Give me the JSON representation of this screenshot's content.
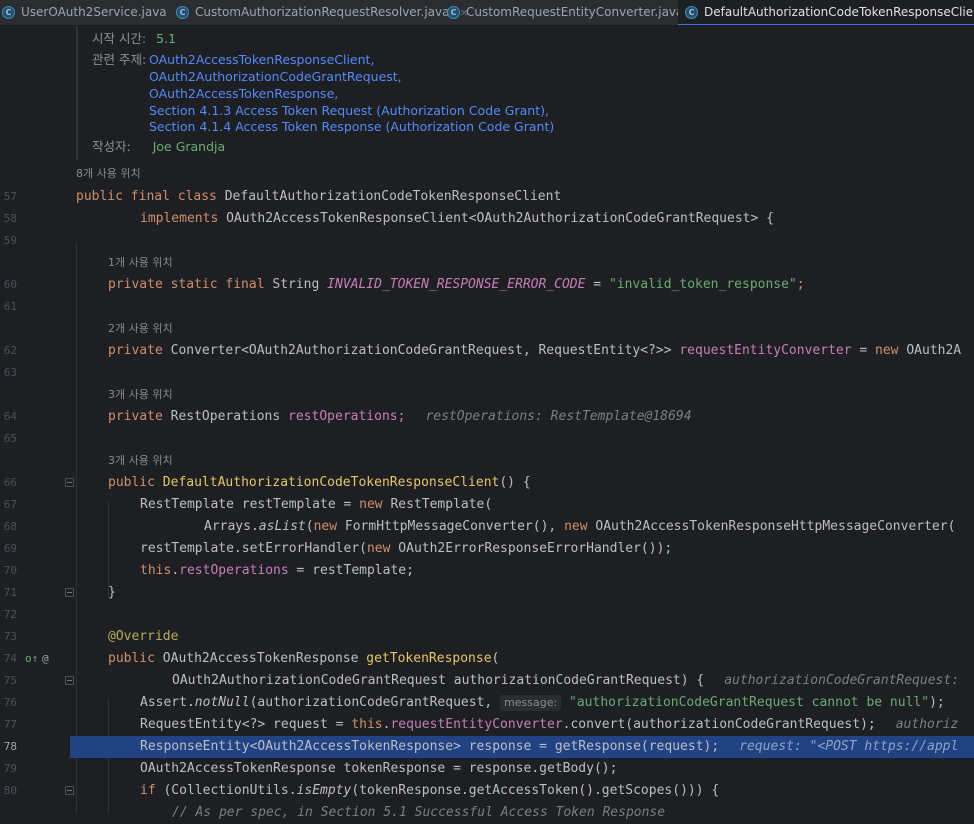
{
  "tabs": [
    {
      "label": "UserOAuth2Service.java",
      "active": false
    },
    {
      "label": "CustomAuthorizationRequestResolver.java",
      "active": false
    },
    {
      "label": "CustomRequestEntityConverter.java",
      "active": false
    },
    {
      "label": "DefaultAuthorizationCodeTokenResponseClient.java",
      "active": true
    }
  ],
  "close_glyph": "×",
  "class_icon_glyph": "C",
  "doc": {
    "since_key": "시작 시간:",
    "since_val": "5.1",
    "see_key": "관련 주제:",
    "see_links": [
      "OAuth2AccessTokenResponseClient,",
      "OAuth2AuthorizationCodeGrantRequest,",
      "OAuth2AccessTokenResponse,",
      "Section 4.1.3 Access Token Request (Authorization Code Grant),",
      "Section 4.1.4 Access Token Response (Authorization Code Grant)"
    ],
    "author_key": "작성자:",
    "author_val": "Joe Grandja"
  },
  "usage_hints": {
    "h57": "8개 사용 위치",
    "h60": "1개 사용 위치",
    "h62": "2개 사용 위치",
    "h64": "3개 사용 위치",
    "h66": "3개 사용 위치"
  },
  "line_numbers": [
    "57",
    "58",
    "59",
    "60",
    "61",
    "62",
    "63",
    "64",
    "65",
    "66",
    "67",
    "68",
    "69",
    "70",
    "71",
    "72",
    "73",
    "74",
    "75",
    "76",
    "77",
    "78",
    "79",
    "80"
  ],
  "current_line": "78",
  "code": {
    "l57": [
      "public final class ",
      "DefaultAuthorizationCodeTokenResponseClient"
    ],
    "l58": [
      "implements ",
      "OAuth2AccessTokenResponseClient<OAuth2AuthorizationCodeGrantRequest> {"
    ],
    "l60": [
      "private static final ",
      "String ",
      "INVALID_TOKEN_RESPONSE_ERROR_CODE",
      " = ",
      "\"invalid_token_response\"",
      ";"
    ],
    "l62": [
      "private ",
      "Converter<OAuth2AuthorizationCodeGrantRequest, RequestEntity<?>> ",
      "requestEntityConverter",
      " = ",
      "new ",
      "OAuth2A"
    ],
    "l64": [
      "private ",
      "RestOperations ",
      "restOperations",
      ";",
      "restOperations: RestTemplate@18694"
    ],
    "l66": [
      "public ",
      "DefaultAuthorizationCodeTokenResponseClient",
      "() {"
    ],
    "l67": [
      "RestTemplate restTemplate = ",
      "new ",
      "RestTemplate("
    ],
    "l68": [
      "Arrays.",
      "asList",
      "(",
      "new ",
      "FormHttpMessageConverter(), ",
      "new ",
      "OAuth2AccessTokenResponseHttpMessageConverter("
    ],
    "l69": [
      "restTemplate.setErrorHandler(",
      "new ",
      "OAuth2ErrorResponseErrorHandler());"
    ],
    "l70": [
      "this",
      ".",
      "restOperations",
      " = restTemplate;"
    ],
    "l71": [
      "}"
    ],
    "l73": [
      "@Override"
    ],
    "l74": [
      "public ",
      "OAuth2AccessTokenResponse ",
      "getTokenResponse",
      "("
    ],
    "l75": [
      "OAuth2AuthorizationCodeGrantRequest authorizationCodeGrantRequest) {",
      "authorizationCodeGrantRequest:"
    ],
    "l76": [
      "Assert.",
      "notNull",
      "(authorizationCodeGrantRequest, ",
      "message:",
      " \"authorizationCodeGrantRequest cannot be null\"",
      ");"
    ],
    "l77": [
      "RequestEntity<?> request = ",
      "this",
      ".",
      "requestEntityConverter",
      ".convert(authorizationCodeGrantRequest);",
      "authoriz"
    ],
    "l78": [
      "ResponseEntity<OAuth2AccessTokenResponse> response = getResponse(request);",
      "request: \"<POST https://appl"
    ],
    "l79": [
      "OAuth2AccessTokenResponse tokenResponse = response.getBody();"
    ],
    "l80": [
      "if ",
      "(CollectionUtils.",
      "isEmpty",
      "(tokenResponse.getAccessToken().getScopes())) {"
    ],
    "l81": [
      "// As per spec, in Section 5.1 Successful Access Token Response"
    ]
  },
  "gutter_icons": {
    "override": "o↑",
    "annotation": "@"
  },
  "colors": {
    "background": "#1e1f22",
    "keyword": "#cf8e6d",
    "method": "#56a8f5",
    "field": "#c77dbb",
    "string": "#6aab73",
    "annotation": "#b3ae60",
    "selection": "#214283"
  }
}
